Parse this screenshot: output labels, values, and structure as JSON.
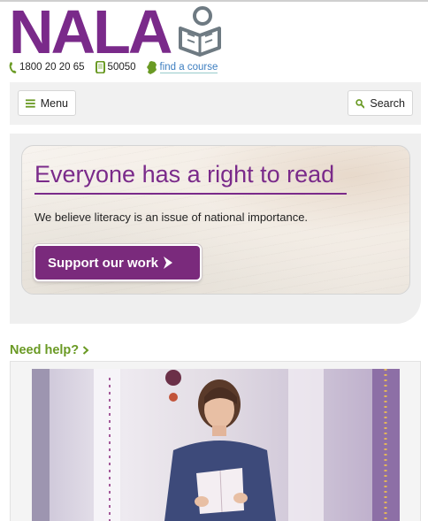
{
  "brand": {
    "logo_text": "NALA",
    "color": "#7a2a8a"
  },
  "contacts": [
    {
      "icon": "phone-icon",
      "text": "1800 20 20 65"
    },
    {
      "icon": "mobile-icon",
      "text": "50050"
    },
    {
      "icon": "ireland-map-icon",
      "text": "find a course"
    }
  ],
  "nav": {
    "menu_label": "Menu",
    "search_label": "Search"
  },
  "hero": {
    "title": "Everyone has a right to read",
    "subtitle": "We believe literacy is an issue of national importance.",
    "cta_label": "Support our work"
  },
  "help": {
    "label": "Need help?"
  },
  "colors": {
    "purple": "#7a2a8a",
    "green": "#6a9a24",
    "link": "#3d7ec0"
  }
}
